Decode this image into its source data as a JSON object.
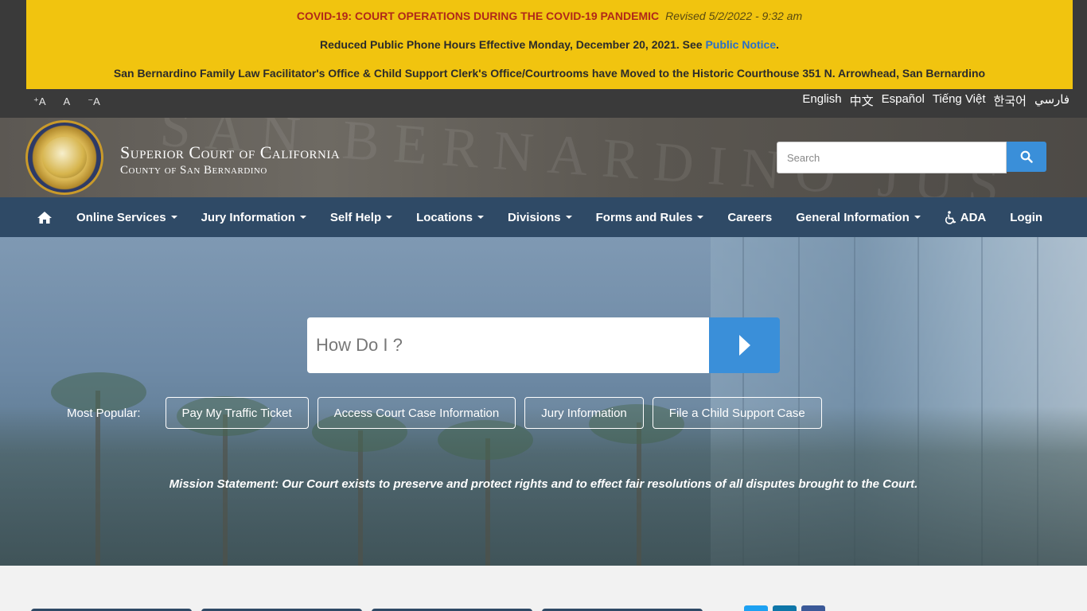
{
  "alert": {
    "line1_title": "COVID-19: COURT OPERATIONS DURING THE COVID-19 PANDEMIC",
    "line1_revised": "Revised 5/2/2022 - 9:32 am",
    "line2_text": "Reduced Public Phone Hours Effective Monday, December 20, 2021. See ",
    "line2_link": "Public Notice",
    "line2_end": ".",
    "line3_text": "San Bernardino Family Law Facilitator's Office & Child Support Clerk's Office/Courtrooms have Moved to the Historic Courthouse 351 N. Arrowhead, San Bernardino"
  },
  "font_sizes": {
    "increase": "⁺A",
    "reset": "A",
    "decrease": "⁻A"
  },
  "languages": [
    "English",
    "中文",
    "Español",
    "Tiếng Việt",
    "한국어",
    "فارسي"
  ],
  "header": {
    "title": "Superior Court of California",
    "subtitle": "County of San Bernardino",
    "background_text": "SAN BERNARDINO JUS",
    "search_placeholder": "Search"
  },
  "nav": {
    "items": [
      {
        "label": "Online Services",
        "dropdown": true
      },
      {
        "label": "Jury Information",
        "dropdown": true
      },
      {
        "label": "Self Help",
        "dropdown": true
      },
      {
        "label": "Locations",
        "dropdown": true
      },
      {
        "label": "Divisions",
        "dropdown": true
      },
      {
        "label": "Forms and Rules",
        "dropdown": true
      },
      {
        "label": "Careers",
        "dropdown": false
      },
      {
        "label": "General Information",
        "dropdown": true
      },
      {
        "label": "ADA",
        "dropdown": false
      },
      {
        "label": "Login",
        "dropdown": false
      }
    ]
  },
  "hero": {
    "howdoi_placeholder": "How Do I ?",
    "popular_label": "Most Popular:",
    "popular": [
      "Pay My Traffic Ticket",
      "Access Court Case Information",
      "Jury Information",
      "File a Child Support Case"
    ],
    "mission": "Mission Statement: Our Court exists to preserve and protect rights and to effect fair resolutions of all disputes brought to the Court."
  },
  "colors": {
    "alert_bg": "#f1c40f",
    "nav_bg": "#2f4a66",
    "accent": "#3a8fd9",
    "alert_title": "#b0281a"
  }
}
